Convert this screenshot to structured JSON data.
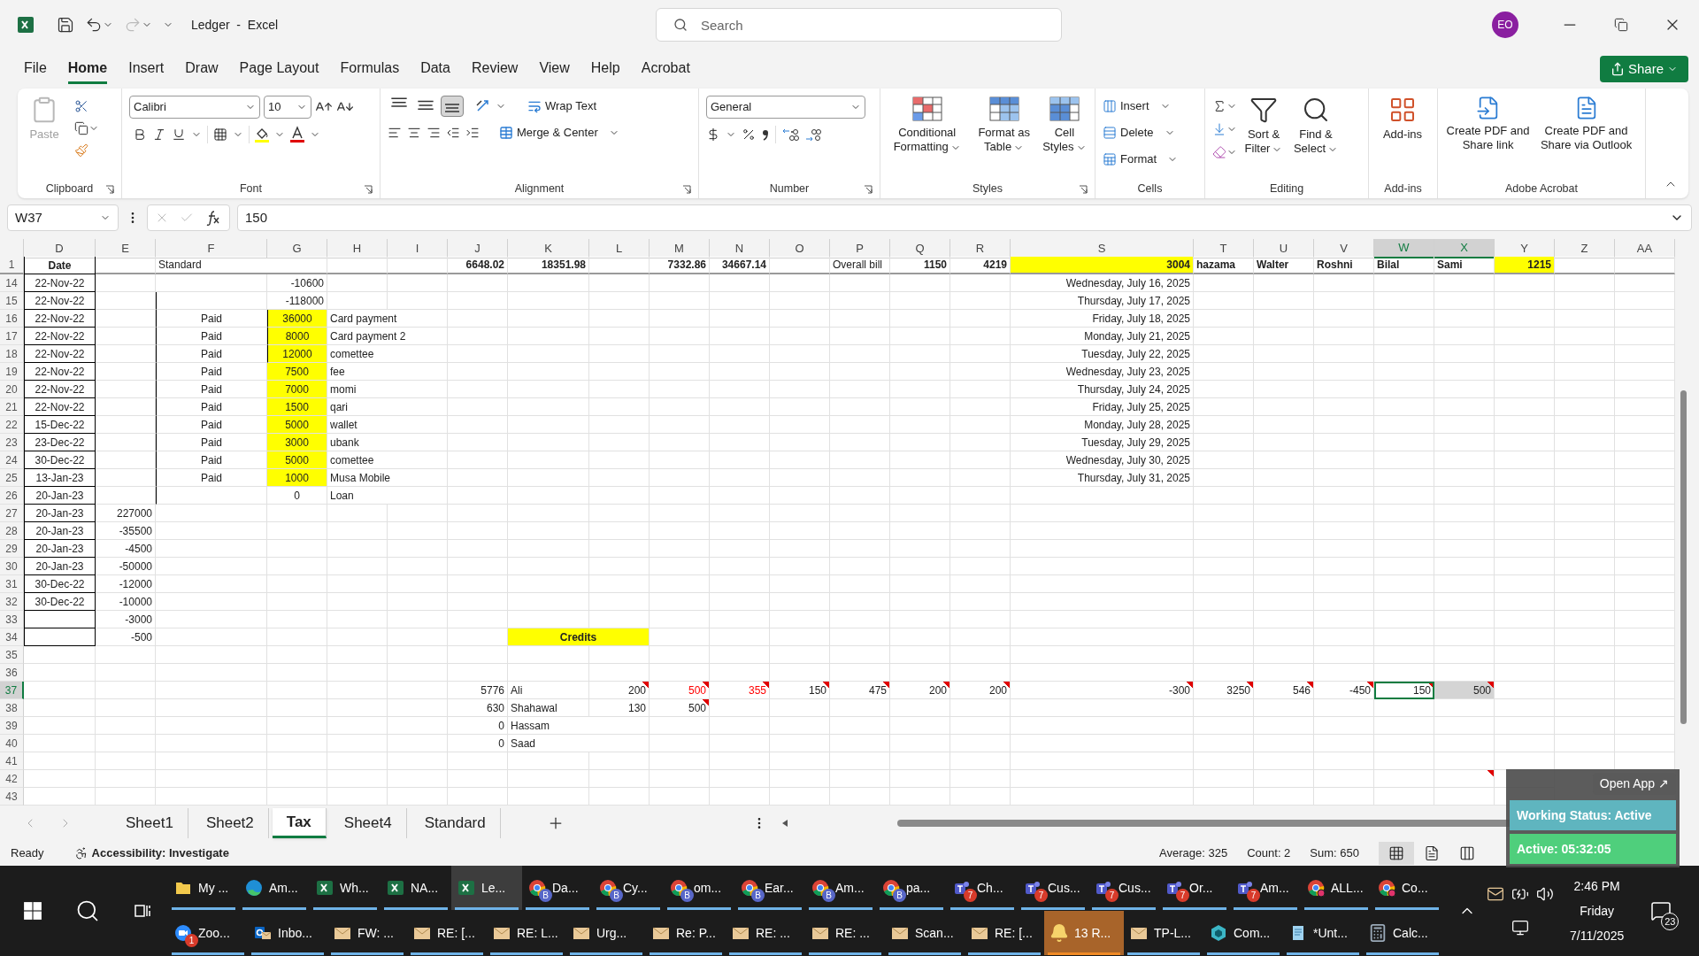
{
  "title_bar": {
    "title": "Ledger  -  Excel",
    "search": {
      "placeholder": "Search"
    },
    "avatar": "EO"
  },
  "menu": [
    {
      "label": "File",
      "selected": false
    },
    {
      "label": "Home",
      "selected": true
    },
    {
      "label": "Insert",
      "selected": false
    },
    {
      "label": "Draw",
      "selected": false
    },
    {
      "label": "Page Layout",
      "selected": false
    },
    {
      "label": "Formulas",
      "selected": false
    },
    {
      "label": "Data",
      "selected": false
    },
    {
      "label": "Review",
      "selected": false
    },
    {
      "label": "View",
      "selected": false
    },
    {
      "label": "Help",
      "selected": false
    },
    {
      "label": "Acrobat",
      "selected": false
    }
  ],
  "share": "Share",
  "ribbon": {
    "groups": [
      {
        "kind": "clipboard",
        "label": "Clipboard",
        "paste": {
          "label": "Paste",
          "disabled": true
        }
      },
      {
        "kind": "font",
        "label": "Font",
        "font": "Calibri",
        "size": "10"
      },
      {
        "kind": "alignment",
        "label": "Alignment",
        "vertical": [
          {
            "selected": false
          },
          {
            "selected": false
          },
          {
            "selected": true
          }
        ],
        "wrap": "Wrap Text",
        "merge": "Merge & Center"
      },
      {
        "kind": "number",
        "label": "Number",
        "format": "General"
      },
      {
        "kind": "styles",
        "label": "Styles",
        "buttons": [
          "Conditional Formatting",
          "Format as Table",
          "Cell Styles"
        ]
      },
      {
        "kind": "cells",
        "label": "Cells",
        "buttons": [
          "Insert",
          "Delete",
          "Format"
        ]
      },
      {
        "kind": "editing",
        "label": "Editing",
        "buttons": [
          "Sort & Filter",
          "Find & Select"
        ]
      },
      {
        "kind": "addins",
        "label": "Add-ins",
        "buttons": [
          "Add-ins"
        ]
      },
      {
        "kind": "acrobat",
        "label": "Adobe Acrobat",
        "buttons": [
          "Create PDF and Share link",
          "Create PDF and Share via Outlook"
        ]
      }
    ]
  },
  "formula_bar": {
    "cell": "W37",
    "value": "150"
  },
  "sheet": {
    "columns": [
      {
        "label": "D",
        "selected": false
      },
      {
        "label": "E",
        "selected": false
      },
      {
        "label": "F",
        "selected": false
      },
      {
        "label": "G",
        "selected": false
      },
      {
        "label": "H",
        "selected": false
      },
      {
        "label": "I",
        "selected": false
      },
      {
        "label": "J",
        "selected": false
      },
      {
        "label": "K",
        "selected": false
      },
      {
        "label": "L",
        "selected": false
      },
      {
        "label": "M",
        "selected": false
      },
      {
        "label": "N",
        "selected": false
      },
      {
        "label": "O",
        "selected": false
      },
      {
        "label": "P",
        "selected": false
      },
      {
        "label": "Q",
        "selected": false
      },
      {
        "label": "R",
        "selected": false
      },
      {
        "label": "S",
        "selected": false
      },
      {
        "label": "T",
        "selected": false
      },
      {
        "label": "U",
        "selected": false
      },
      {
        "label": "V",
        "selected": false
      },
      {
        "label": "W",
        "selected": true
      },
      {
        "label": "X",
        "selected": true
      },
      {
        "label": "Y",
        "selected": false
      },
      {
        "label": "Z",
        "selected": false
      },
      {
        "label": "AA",
        "selected": false
      }
    ],
    "rows": [
      {
        "number": "1",
        "selected": false,
        "cells": {
          "D": {
            "text": "Date",
            "kind": "centered",
            "bold": true,
            "boxed": true
          },
          "F": {
            "text": "Standard",
            "kind": "text"
          },
          "J": {
            "text": "6648.02",
            "kind": "number",
            "bold": true
          },
          "K": {
            "text": "18351.98",
            "kind": "number",
            "bold": true
          },
          "M": {
            "text": "7332.86",
            "kind": "number",
            "bold": true
          },
          "N": {
            "text": "34667.14",
            "kind": "number",
            "bold": true
          },
          "P": {
            "text": "Overall bill",
            "kind": "text"
          },
          "Q": {
            "text": "1150",
            "kind": "number",
            "bold": true
          },
          "R": {
            "text": "4219",
            "kind": "number",
            "bold": true
          },
          "S": {
            "text": "3004",
            "kind": "number",
            "bold": true,
            "highlight": true
          },
          "T": {
            "text": "hazama",
            "kind": "text",
            "bold": true
          },
          "U": {
            "text": "Walter",
            "kind": "text",
            "bold": true
          },
          "V": {
            "text": "Roshni",
            "kind": "text",
            "bold": true
          },
          "W": {
            "text": "Bilal",
            "kind": "text",
            "bold": true
          },
          "X": {
            "text": "Sami",
            "kind": "text",
            "bold": true
          },
          "Y": {
            "text": "1215",
            "kind": "number",
            "bold": true,
            "highlight": true
          }
        }
      },
      {
        "number": "14",
        "selected": false,
        "cells": {
          "D": {
            "text": "22-Nov-22",
            "kind": "centered",
            "boxed": true
          },
          "G": {
            "text": "-10600",
            "kind": "number"
          },
          "S": {
            "text": "Wednesday, July 16, 2025",
            "kind": "number"
          }
        }
      },
      {
        "number": "15",
        "selected": false,
        "cells": {
          "D": {
            "text": "22-Nov-22",
            "kind": "centered",
            "boxed": true
          },
          "F": {
            "ruled": true
          },
          "G": {
            "text": "-118000",
            "kind": "number"
          },
          "S": {
            "text": "Thursday, July 17, 2025",
            "kind": "number"
          }
        }
      },
      {
        "number": "16",
        "selected": false,
        "cells": {
          "D": {
            "text": "22-Nov-22",
            "kind": "centered",
            "boxed": true
          },
          "F": {
            "text": "Paid",
            "kind": "centered",
            "ruled": true
          },
          "G": {
            "text": "36000",
            "kind": "centered",
            "highlight": true,
            "ruled": true
          },
          "H": {
            "text": "Card payment",
            "kind": "text"
          },
          "S": {
            "text": "Friday, July 18, 2025",
            "kind": "number"
          }
        }
      },
      {
        "number": "17",
        "selected": false,
        "cells": {
          "D": {
            "text": "22-Nov-22",
            "kind": "centered",
            "boxed": true
          },
          "F": {
            "text": "Paid",
            "kind": "centered",
            "ruled": true
          },
          "G": {
            "text": "8000",
            "kind": "centered",
            "highlight": true,
            "ruled": true
          },
          "H": {
            "text": "Card payment 2",
            "kind": "text"
          },
          "S": {
            "text": "Monday, July 21, 2025",
            "kind": "number"
          }
        }
      },
      {
        "number": "18",
        "selected": false,
        "cells": {
          "D": {
            "text": "22-Nov-22",
            "kind": "centered",
            "boxed": true
          },
          "F": {
            "text": "Paid",
            "kind": "centered",
            "ruled": true
          },
          "G": {
            "text": "12000",
            "kind": "centered",
            "highlight": true,
            "ruled": true
          },
          "H": {
            "text": "comettee",
            "kind": "text"
          },
          "S": {
            "text": "Tuesday, July 22, 2025",
            "kind": "number"
          }
        }
      },
      {
        "number": "19",
        "selected": false,
        "cells": {
          "D": {
            "text": "22-Nov-22",
            "kind": "centered",
            "boxed": true
          },
          "F": {
            "text": "Paid",
            "kind": "centered",
            "ruled": true
          },
          "G": {
            "text": "7500",
            "kind": "centered",
            "highlight": true
          },
          "H": {
            "text": "fee",
            "kind": "text"
          },
          "S": {
            "text": "Wednesday, July 23, 2025",
            "kind": "number"
          }
        }
      },
      {
        "number": "20",
        "selected": false,
        "cells": {
          "D": {
            "text": "22-Nov-22",
            "kind": "centered",
            "boxed": true
          },
          "F": {
            "text": "Paid",
            "kind": "centered",
            "ruled": true
          },
          "G": {
            "text": "7000",
            "kind": "centered",
            "highlight": true
          },
          "H": {
            "text": "momi",
            "kind": "text"
          },
          "S": {
            "text": "Thursday, July 24, 2025",
            "kind": "number"
          }
        }
      },
      {
        "number": "21",
        "selected": false,
        "cells": {
          "D": {
            "text": "22-Nov-22",
            "kind": "centered",
            "boxed": true
          },
          "F": {
            "text": "Paid",
            "kind": "centered",
            "ruled": true
          },
          "G": {
            "text": "1500",
            "kind": "centered",
            "highlight": true
          },
          "H": {
            "text": "qari",
            "kind": "text"
          },
          "S": {
            "text": "Friday, July 25, 2025",
            "kind": "number"
          }
        }
      },
      {
        "number": "22",
        "selected": false,
        "cells": {
          "D": {
            "text": "15-Dec-22",
            "kind": "centered",
            "boxed": true
          },
          "F": {
            "text": "Paid",
            "kind": "centered",
            "ruled": true
          },
          "G": {
            "text": "5000",
            "kind": "centered",
            "highlight": true
          },
          "H": {
            "text": "wallet",
            "kind": "text"
          },
          "S": {
            "text": "Monday, July 28, 2025",
            "kind": "number"
          }
        }
      },
      {
        "number": "23",
        "selected": false,
        "cells": {
          "D": {
            "text": "23-Dec-22",
            "kind": "centered",
            "boxed": true
          },
          "F": {
            "text": "Paid",
            "kind": "centered",
            "ruled": true
          },
          "G": {
            "text": "3000",
            "kind": "centered",
            "highlight": true
          },
          "H": {
            "text": "ubank",
            "kind": "text"
          },
          "S": {
            "text": "Tuesday, July 29, 2025",
            "kind": "number"
          }
        }
      },
      {
        "number": "24",
        "selected": false,
        "cells": {
          "D": {
            "text": "30-Dec-22",
            "kind": "centered",
            "boxed": true
          },
          "F": {
            "text": "Paid",
            "kind": "centered",
            "ruled": true
          },
          "G": {
            "text": "5000",
            "kind": "centered",
            "highlight": true
          },
          "H": {
            "text": "comettee",
            "kind": "text"
          },
          "S": {
            "text": "Wednesday, July 30, 2025",
            "kind": "number"
          }
        }
      },
      {
        "number": "25",
        "selected": false,
        "cells": {
          "D": {
            "text": "13-Jan-23",
            "kind": "centered",
            "boxed": true
          },
          "F": {
            "text": "Paid",
            "kind": "centered",
            "ruled": true
          },
          "G": {
            "text": "1000",
            "kind": "centered",
            "highlight": true
          },
          "H": {
            "text": "Musa Mobile",
            "kind": "text"
          },
          "S": {
            "text": "Thursday, July 31, 2025",
            "kind": "number"
          }
        }
      },
      {
        "number": "26",
        "selected": false,
        "cells": {
          "D": {
            "text": "20-Jan-23",
            "kind": "centered",
            "boxed": true
          },
          "F": {
            "ruled": true
          },
          "G": {
            "text": "0",
            "kind": "centered"
          },
          "H": {
            "text": "Loan",
            "kind": "text"
          }
        }
      },
      {
        "number": "27",
        "selected": false,
        "cells": {
          "D": {
            "text": "20-Jan-23",
            "kind": "centered",
            "boxed": true
          },
          "E": {
            "text": "227000",
            "kind": "number"
          }
        }
      },
      {
        "number": "28",
        "selected": false,
        "cells": {
          "D": {
            "text": "20-Jan-23",
            "kind": "centered",
            "boxed": true
          },
          "E": {
            "text": "-35500",
            "kind": "number"
          }
        }
      },
      {
        "number": "29",
        "selected": false,
        "cells": {
          "D": {
            "text": "20-Jan-23",
            "kind": "centered",
            "boxed": true
          },
          "E": {
            "text": "-4500",
            "kind": "number"
          }
        }
      },
      {
        "number": "30",
        "selected": false,
        "cells": {
          "D": {
            "text": "20-Jan-23",
            "kind": "centered",
            "boxed": true
          },
          "E": {
            "text": "-50000",
            "kind": "number"
          }
        }
      },
      {
        "number": "31",
        "selected": false,
        "cells": {
          "D": {
            "text": "30-Dec-22",
            "kind": "centered",
            "boxed": true
          },
          "E": {
            "text": "-12000",
            "kind": "number"
          }
        }
      },
      {
        "number": "32",
        "selected": false,
        "cells": {
          "D": {
            "text": "30-Dec-22",
            "kind": "centered",
            "boxed": true
          },
          "E": {
            "text": "-10000",
            "kind": "number"
          }
        }
      },
      {
        "number": "33",
        "selected": false,
        "cells": {
          "D": {
            "boxed": true
          },
          "E": {
            "text": "-3000",
            "kind": "number"
          }
        }
      },
      {
        "number": "34",
        "selected": false,
        "cells": {
          "D": {
            "boxed": true
          },
          "E": {
            "text": "-500",
            "kind": "number"
          },
          "K": {
            "text": "Credits",
            "kind": "centered",
            "bold": true,
            "highlight": true,
            "merged": true
          }
        }
      },
      {
        "number": "35",
        "selected": false
      },
      {
        "number": "36",
        "selected": false
      },
      {
        "number": "37",
        "selected": true,
        "cells": {
          "J": {
            "text": "5776",
            "kind": "number"
          },
          "K": {
            "text": "Ali",
            "kind": "text"
          },
          "L": {
            "text": "200",
            "kind": "number",
            "note": true
          },
          "M": {
            "text": "500",
            "kind": "number",
            "flagged": true,
            "note": true
          },
          "N": {
            "text": "355",
            "kind": "number",
            "flagged": true,
            "note": true
          },
          "O": {
            "text": "150",
            "kind": "number",
            "note": true
          },
          "P": {
            "text": "475",
            "kind": "number",
            "note": true
          },
          "Q": {
            "text": "200",
            "kind": "number",
            "note": true
          },
          "R": {
            "text": "200",
            "kind": "number",
            "note": true
          },
          "S": {
            "text": "-300",
            "kind": "number",
            "note": true
          },
          "T": {
            "text": "3250",
            "kind": "number",
            "note": true
          },
          "U": {
            "text": "546",
            "kind": "number",
            "note": true
          },
          "V": {
            "text": "-450",
            "kind": "number",
            "note": true
          },
          "W": {
            "text": "150",
            "kind": "number",
            "note": true,
            "active": true
          },
          "X": {
            "text": "500",
            "kind": "number",
            "note": true,
            "selected": true
          }
        }
      },
      {
        "number": "38",
        "selected": false,
        "cells": {
          "J": {
            "text": "630",
            "kind": "number"
          },
          "K": {
            "text": "Shahawal",
            "kind": "text"
          },
          "L": {
            "text": "130",
            "kind": "number"
          },
          "M": {
            "text": "500",
            "kind": "number",
            "note": true
          }
        }
      },
      {
        "number": "39",
        "selected": false,
        "cells": {
          "J": {
            "text": "0",
            "kind": "number"
          },
          "K": {
            "text": "Hassam",
            "kind": "text"
          }
        }
      },
      {
        "number": "40",
        "selected": false,
        "cells": {
          "J": {
            "text": "0",
            "kind": "number"
          },
          "K": {
            "text": "Saad",
            "kind": "text"
          }
        }
      },
      {
        "number": "41",
        "selected": false
      },
      {
        "number": "42",
        "selected": false,
        "cells": {
          "X": {
            "note": true
          }
        }
      },
      {
        "number": "43",
        "selected": false
      }
    ]
  },
  "sheet_tabs": [
    {
      "label": "Sheet1",
      "selected": false
    },
    {
      "label": "Sheet2",
      "selected": false
    },
    {
      "label": "Tax",
      "selected": true
    },
    {
      "label": "Sheet4",
      "selected": false
    },
    {
      "label": "Standard",
      "selected": false
    }
  ],
  "status_bar": {
    "mode": "Ready",
    "accessibility": "Accessibility: Investigate",
    "stats": [
      "Average: 325",
      "Count: 2",
      "Sum: 650"
    ],
    "views": [
      {
        "selected": true
      },
      {
        "selected": false
      },
      {
        "selected": false
      }
    ]
  },
  "overlay": {
    "open": "Open App ↗",
    "status": "Working Status: Active",
    "timer": "Active: 05:32:05"
  },
  "taskbar": {
    "row1": [
      {
        "kind": "folder",
        "label": "My ...",
        "selected": false,
        "flashing": false
      },
      {
        "kind": "edge",
        "label": "Am...",
        "selected": false,
        "flashing": false
      },
      {
        "kind": "excel",
        "label": "Wh...",
        "selected": false,
        "flashing": false
      },
      {
        "kind": "excel",
        "label": "NA...",
        "selected": false,
        "flashing": false
      },
      {
        "kind": "excel",
        "label": "Le...",
        "selected": true,
        "flashing": false
      },
      {
        "kind": "chrome",
        "label": "Da...",
        "badge": "B",
        "selected": false,
        "flashing": false
      },
      {
        "kind": "chrome",
        "label": "Cy...",
        "badge": "B",
        "selected": false,
        "flashing": false
      },
      {
        "kind": "chrome",
        "label": "om...",
        "badge": "B",
        "selected": false,
        "flashing": false
      },
      {
        "kind": "chrome",
        "label": "Ear...",
        "badge": "B",
        "selected": false,
        "flashing": false
      },
      {
        "kind": "chrome",
        "label": "Am...",
        "badge": "B",
        "selected": false,
        "flashing": false
      },
      {
        "kind": "chrome",
        "label": "pa...",
        "badge": "B",
        "selected": false,
        "flashing": false
      },
      {
        "kind": "teams",
        "label": "Ch...",
        "badge": "7",
        "selected": false,
        "flashing": false
      },
      {
        "kind": "teams",
        "label": "Cus...",
        "badge": "7",
        "selected": false,
        "flashing": false
      },
      {
        "kind": "teams",
        "label": "Cus...",
        "badge": "7",
        "selected": false,
        "flashing": false
      },
      {
        "kind": "teams",
        "label": "Or...",
        "badge": "7",
        "selected": false,
        "flashing": false
      },
      {
        "kind": "teams",
        "label": "Am...",
        "badge": "7",
        "selected": false,
        "flashing": false
      },
      {
        "kind": "chromedot",
        "label": "ALL...",
        "selected": false,
        "flashing": false
      },
      {
        "kind": "chromedot",
        "label": "Co...",
        "selected": false,
        "flashing": false
      }
    ],
    "row2": [
      {
        "kind": "zoom",
        "label": "Zoo...",
        "badge": "1",
        "selected": false,
        "flashing": false
      },
      {
        "kind": "outlook",
        "label": "Inbo...",
        "selected": false,
        "flashing": false
      },
      {
        "kind": "mail",
        "label": "FW: ...",
        "selected": false,
        "flashing": false
      },
      {
        "kind": "mail",
        "label": "RE: [...",
        "selected": false,
        "flashing": false
      },
      {
        "kind": "mail",
        "label": "RE: L...",
        "selected": false,
        "flashing": false
      },
      {
        "kind": "mail",
        "label": "Urg...",
        "selected": false,
        "flashing": false
      },
      {
        "kind": "mail",
        "label": "Re: P...",
        "selected": false,
        "flashing": false
      },
      {
        "kind": "mail",
        "label": "RE: ...",
        "selected": false,
        "flashing": false
      },
      {
        "kind": "mail",
        "label": "RE: ...",
        "selected": false,
        "flashing": false
      },
      {
        "kind": "mail",
        "label": "Scan...",
        "selected": false,
        "flashing": false
      },
      {
        "kind": "mail",
        "label": "RE: [...",
        "selected": false,
        "flashing": false
      },
      {
        "kind": "bell",
        "label": "13 R...",
        "selected": false,
        "flashing": true
      },
      {
        "kind": "mail",
        "label": "TP-L...",
        "selected": false,
        "flashing": false
      },
      {
        "kind": "cube",
        "label": "Com...",
        "selected": false,
        "flashing": false
      },
      {
        "kind": "notepad",
        "label": "*Unt...",
        "selected": false,
        "flashing": false
      },
      {
        "kind": "calc",
        "label": "Calc...",
        "selected": false,
        "flashing": false
      }
    ],
    "tray": {
      "time": "2:46 PM",
      "day": "Friday",
      "date": "7/11/2025",
      "notifications": "23"
    }
  }
}
